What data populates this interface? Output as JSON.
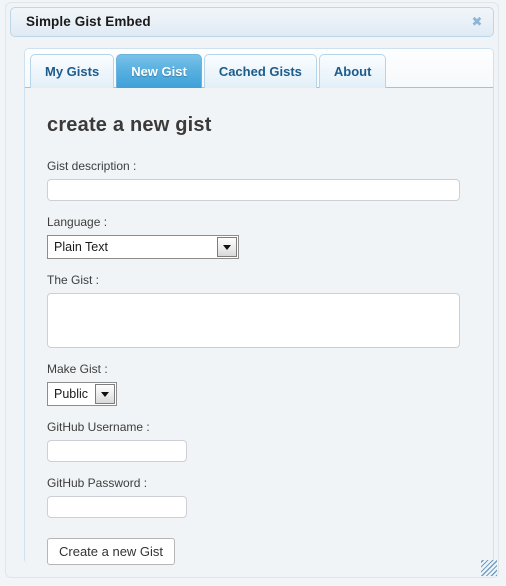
{
  "window": {
    "title": "Simple Gist Embed",
    "close_icon": "close-icon",
    "close_glyph": "✖",
    "resize_handle": "resize-grip"
  },
  "tabs": {
    "items": [
      {
        "label": "My Gists",
        "active": false
      },
      {
        "label": "New Gist",
        "active": true
      },
      {
        "label": "Cached Gists",
        "active": false
      },
      {
        "label": "About",
        "active": false
      }
    ]
  },
  "form": {
    "heading": "create a new gist",
    "description": {
      "label": "Gist description :",
      "value": "",
      "placeholder": ""
    },
    "language": {
      "label": "Language :",
      "selected": "Plain Text"
    },
    "gist": {
      "label": "The Gist :",
      "value": "",
      "placeholder": ""
    },
    "visibility": {
      "label": "Make Gist :",
      "selected": "Public"
    },
    "username": {
      "label": "GitHub Username :",
      "value": "",
      "placeholder": ""
    },
    "password": {
      "label": "GitHub Password :",
      "value": "",
      "placeholder": ""
    },
    "submit_label": "Create a new Gist"
  },
  "colors": {
    "accent": "#3ea1d8",
    "tab_text": "#1c5c8c",
    "panel_bg": "#f1f4f6",
    "titlebar_border": "#bcd7ea"
  }
}
